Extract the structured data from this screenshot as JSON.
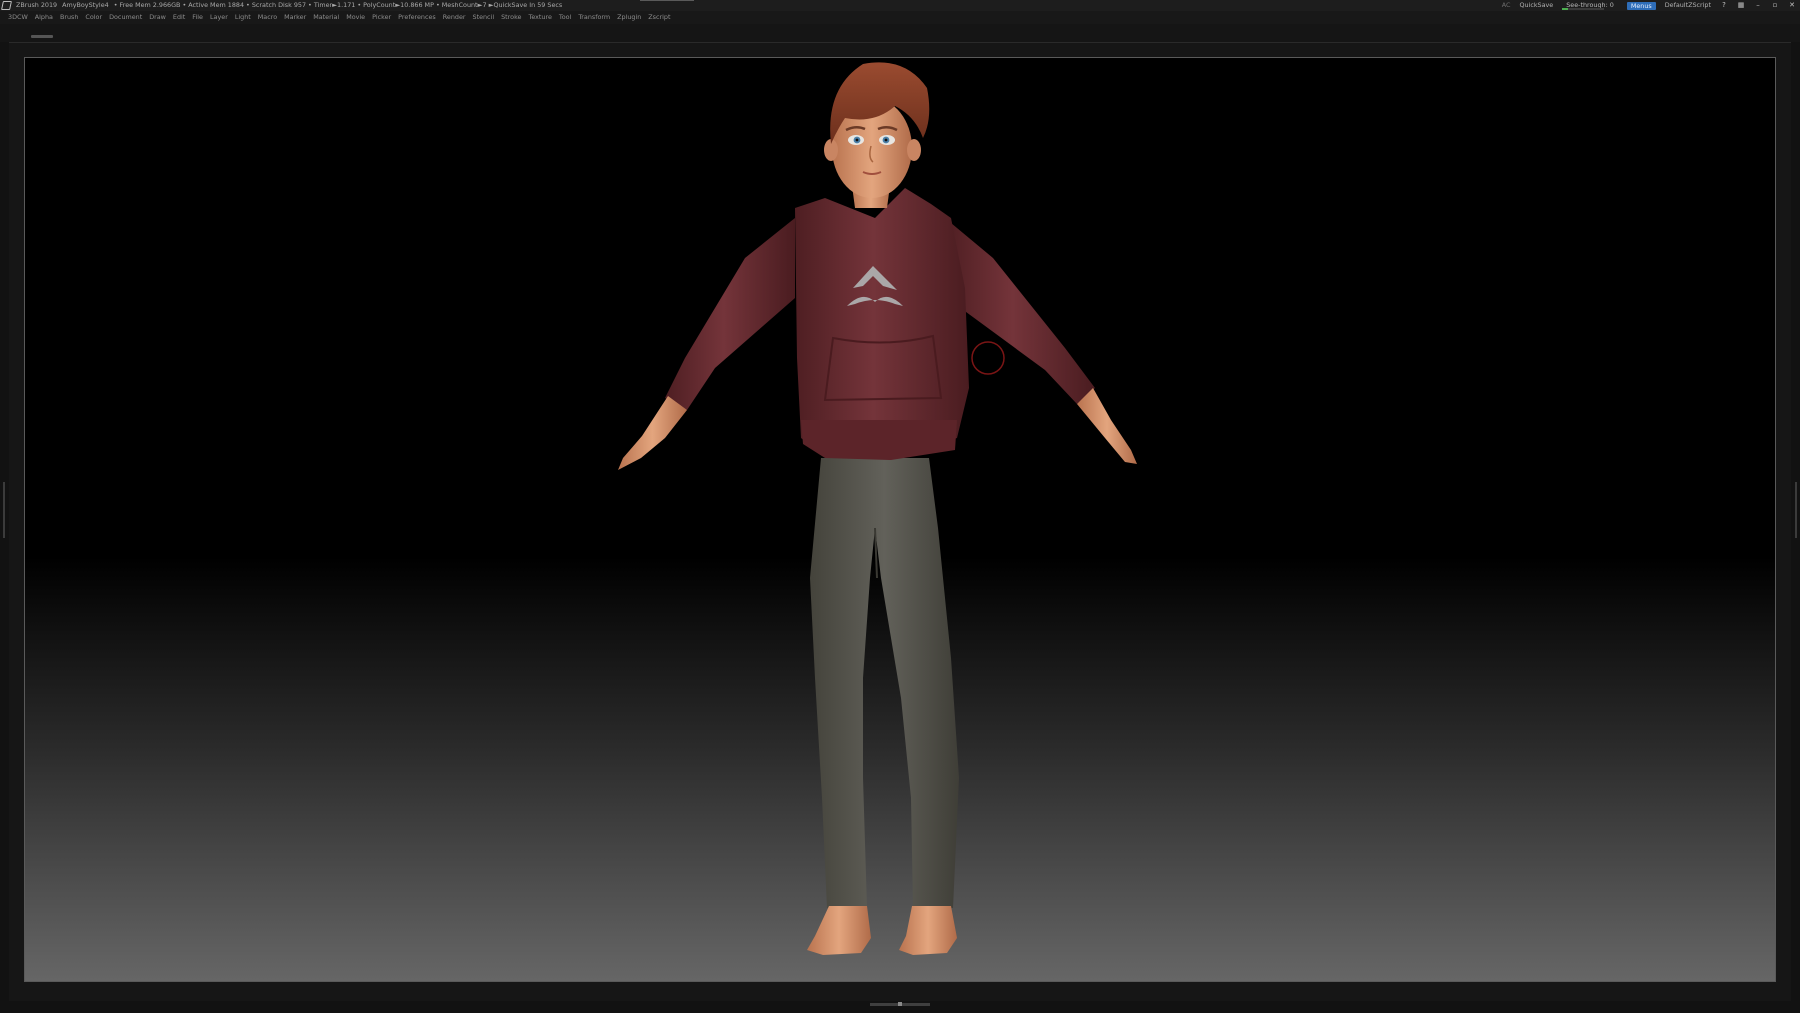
{
  "titlebar": {
    "app": "ZBrush 2019",
    "document": "AmyBoyStyle4",
    "status": "• Free Mem 2.966GB • Active Mem 1884 • Scratch Disk 957 • Timer►1.171 • PolyCount►10.866 MP • MeshCount►7 ►QuickSave In 59 Secs",
    "ac_label": "AC",
    "quicksave_label": "QuickSave",
    "seethrough_label": "See-through",
    "seethrough_value": "0",
    "menus_label": "Menus",
    "script_label": "DefaultZScript"
  },
  "menubar": {
    "items": [
      "3DCW",
      "Alpha",
      "Brush",
      "Color",
      "Document",
      "Draw",
      "Edit",
      "File",
      "Layer",
      "Light",
      "Macro",
      "Marker",
      "Material",
      "Movie",
      "Picker",
      "Preferences",
      "Render",
      "Stencil",
      "Stroke",
      "Texture",
      "Tool",
      "Transform",
      "Zplugin",
      "Zscript"
    ]
  },
  "icons": {
    "logo": "zbrush-logo-icon",
    "help": "help-icon",
    "layout": "layout-icon",
    "minimize": "minimize-icon",
    "maximize": "maximize-icon",
    "close": "close-icon"
  },
  "colors": {
    "menus_active": "#2e6db8",
    "brush_cursor": "#8b1a1a",
    "hoodie": "#6a2d31",
    "pants": "#5b5a50",
    "skin": "#d99a74",
    "hair": "#8a3f28"
  }
}
